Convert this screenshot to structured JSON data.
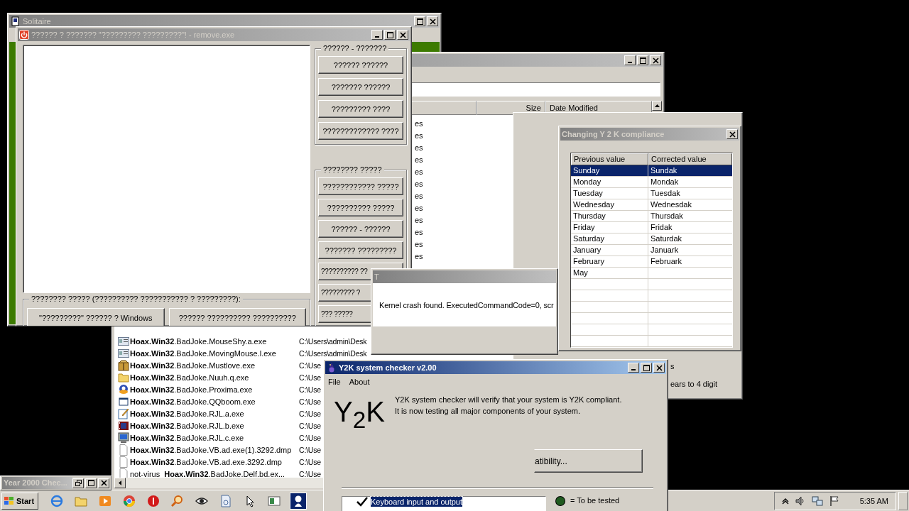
{
  "solitaire": {
    "title": "Solitaire",
    "active": false
  },
  "explorer": {
    "active": false,
    "columns": [
      "Size",
      "Date Modified"
    ],
    "fragments": [
      "es",
      "es",
      "es",
      "es",
      "es",
      "es",
      "es",
      "es",
      "es",
      "es",
      "es",
      "es"
    ],
    "files": [
      {
        "kind": "app",
        "name": "**Hoax.Win32**.BadJoke.MouseShy.a.exe",
        "path": "C:\\Users\\admin\\Desk"
      },
      {
        "kind": "app",
        "name": "**Hoax.Win32**.BadJoke.MovingMouse.l.exe",
        "path": "C:\\Users\\admin\\Desk"
      },
      {
        "kind": "package",
        "name": "**Hoax.Win32**.BadJoke.Mustlove.exe",
        "path": "C:\\Use"
      },
      {
        "kind": "folder",
        "name": "**Hoax.Win32**.BadJoke.Nuuh.q.exe",
        "path": "C:\\Use"
      },
      {
        "kind": "cartoon",
        "name": "**Hoax.Win32**.BadJoke.Proxima.exe",
        "path": "C:\\Use"
      },
      {
        "kind": "frame",
        "name": "**Hoax.Win32**.BadJoke.QQboom.exe",
        "path": "C:\\Use"
      },
      {
        "kind": "notepad",
        "name": "**Hoax.Win32**.BadJoke.RJL.a.exe",
        "path": "C:\\Use"
      },
      {
        "kind": "film",
        "name": "**Hoax.Win32**.BadJoke.RJL.b.exe",
        "path": "C:\\Use"
      },
      {
        "kind": "monitor",
        "name": "**Hoax.Win32**.BadJoke.RJL.c.exe",
        "path": "C:\\Use"
      },
      {
        "kind": "document",
        "name": "**Hoax.Win32**.BadJoke.VB.ad.exe(1).3292.dmp",
        "path": "C:\\Use"
      },
      {
        "kind": "document",
        "name": "**Hoax.Win32**.BadJoke.VB.ad.exe.3292.dmp",
        "path": "C:\\Use"
      },
      {
        "kind": "document",
        "name": "not-virus_**Hoax.Win32**.BadJoke.Delf.bd.ex...",
        "path": "C:\\Use"
      }
    ]
  },
  "hidden_dialog": {
    "texts": [
      "s",
      "ears to 4 digit"
    ]
  },
  "remover": {
    "title": "?????? ? ??????? \"????????? ?????????\"! - remove.exe",
    "active": false,
    "groups": [
      {
        "label": "?????? - ???????",
        "buttons": [
          "?????? ??????",
          "??????? ??????",
          "????????? ????",
          "????????????? ????"
        ]
      },
      {
        "label": "???????? ?????",
        "buttons": [
          "???????????? ?????",
          "?????????? ?????",
          "?????? - ??????",
          "??????? ?????????",
          "?????????? ??",
          "????????? ?",
          "??? ?????"
        ]
      }
    ],
    "bottom": {
      "label": "???????? ????? (?????????? ??????????? ? ?????????):",
      "buttons": [
        "\"?????????\" ?????? ? Windows",
        "?????? ?????????? ??????????"
      ]
    }
  },
  "crash": {
    "title": "T",
    "active": false,
    "message": "Kernel crash found. ExecutedCommandCode=0, scr"
  },
  "compliance": {
    "title": "Changing Y 2 K compliance",
    "active": false,
    "columns": [
      "Previous value",
      "Corrected value"
    ],
    "rows": [
      {
        "previous": "Sunday",
        "corrected": "Sundak",
        "selected": true
      },
      {
        "previous": "Monday",
        "corrected": "Mondak",
        "selected": false
      },
      {
        "previous": "Tuesday",
        "corrected": "Tuesdak",
        "selected": false
      },
      {
        "previous": "Wednesday",
        "corrected": "Wednesdak",
        "selected": false
      },
      {
        "previous": "Thursday",
        "corrected": "Thursdak",
        "selected": false
      },
      {
        "previous": "Friday",
        "corrected": "Fridak",
        "selected": false
      },
      {
        "previous": "Saturday",
        "corrected": "Saturdak",
        "selected": false
      },
      {
        "previous": "January",
        "corrected": "Januark",
        "selected": false
      },
      {
        "previous": "February",
        "corrected": "Februark",
        "selected": false
      },
      {
        "previous": "May",
        "selected": false
      }
    ]
  },
  "checker": {
    "title": "Y2K system checker v2.00",
    "active": true,
    "menu": [
      "File",
      "About"
    ],
    "logo": "Y$_{2}$K",
    "description": [
      "Y2K system checker will verify that your system is Y2K compliant.",
      "It is now testing all major components of your system."
    ],
    "button": "atibility...",
    "tests": [
      {
        "label": "Keyboard input and output",
        "checked": true,
        "selected": true
      }
    ],
    "legend": [
      {
        "color": "#1f5a1f",
        "label": "= To be tested"
      }
    ]
  },
  "minimized": {
    "title": "Year 2000 Chec..."
  },
  "taskbar": {
    "start": "Start",
    "clock": "5:35 AM",
    "apps": [
      {
        "kind": "globe",
        "active": false
      },
      {
        "kind": "folder",
        "active": false
      },
      {
        "kind": "play",
        "active": false
      },
      {
        "kind": "wheel",
        "active": false
      },
      {
        "kind": "alert",
        "active": false
      },
      {
        "kind": "magnifier",
        "active": false
      },
      {
        "kind": "eye",
        "active": false
      },
      {
        "kind": "document",
        "active": false
      },
      {
        "kind": "cursor",
        "active": false
      },
      {
        "kind": "window",
        "active": false
      },
      {
        "kind": "figure",
        "active": true
      }
    ]
  }
}
